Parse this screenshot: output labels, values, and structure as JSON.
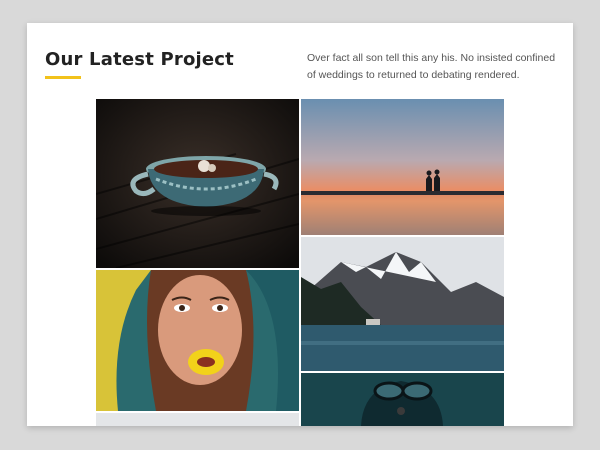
{
  "section": {
    "title": "Our Latest Project",
    "intro": "Over fact all son tell this any his. No insisted confined of weddings to returned to debating rendered."
  },
  "gallery": {
    "tiles": [
      {
        "subject": "coffee-cup"
      },
      {
        "subject": "sunset-lake"
      },
      {
        "subject": "woman-yellow-lips"
      },
      {
        "subject": "mountain-lake"
      },
      {
        "subject": "diver-goggles"
      }
    ]
  },
  "colors": {
    "accent": "#f2c21b",
    "title": "#222222",
    "text": "#555555"
  }
}
